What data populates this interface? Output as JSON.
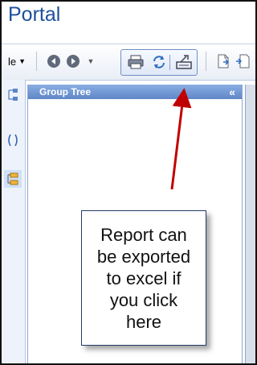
{
  "window": {
    "title": "Portal"
  },
  "toolbar": {
    "partial_label": "le",
    "icons": [
      "dropdown-icon",
      "back-icon",
      "forward-icon",
      "print-icon",
      "refresh-icon",
      "export-icon",
      "document-icon",
      "next-page-icon"
    ]
  },
  "group_tree": {
    "title": "Group Tree",
    "collapse_label": "«"
  },
  "callout": {
    "text": "Report can\nbe exported\nto excel if\nyou click\nhere"
  },
  "colors": {
    "title": "#1e4f9c",
    "arrow": "#c00000",
    "header": "#5f86c8"
  }
}
